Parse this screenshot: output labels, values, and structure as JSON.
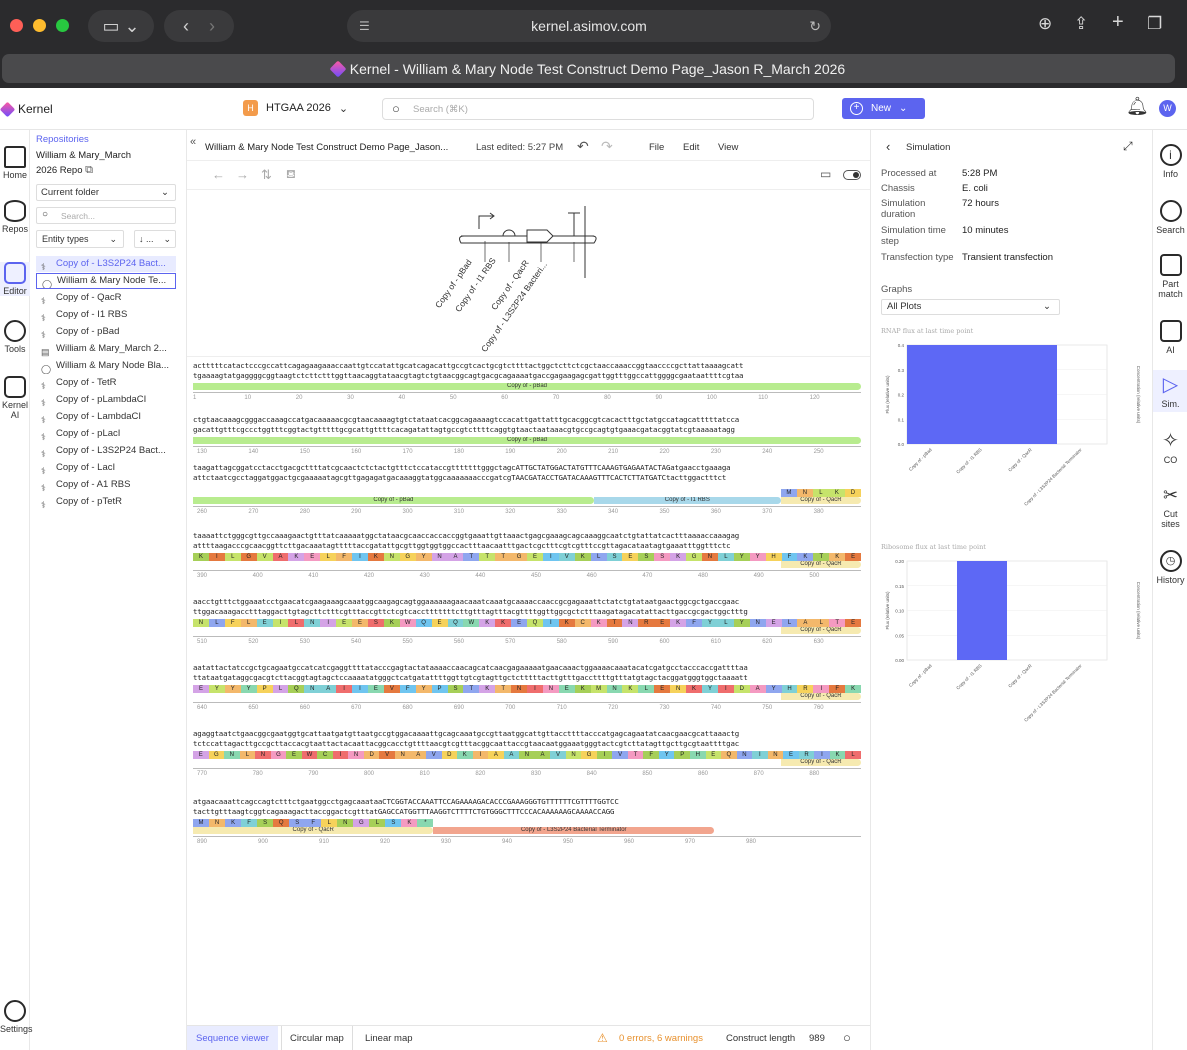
{
  "browser": {
    "url": "kernel.asimov.com",
    "tab_title": "Kernel - William & Mary Node Test Construct Demo Page_Jason R_March 2026"
  },
  "app": {
    "name": "Kernel",
    "workspace_badge": "H",
    "workspace": "HTGAA 2026",
    "search_placeholder": "Search (⌘K)",
    "new_label": "New",
    "avatar": "W"
  },
  "left_rail": [
    "Home",
    "Repos",
    "Editor",
    "Tools",
    "Kernel AI",
    "Settings"
  ],
  "repo_panel": {
    "breadcrumb": "Repositories",
    "repo_name": "William & Mary_March 2026 Repo",
    "folder_select": "Current folder",
    "search_placeholder": "Search...",
    "entity_types": "Entity types",
    "sort": "↓ ...",
    "entities": [
      {
        "label": "Copy of - L3S2P24 Bact...",
        "icon": "dna-icon",
        "state": "selected"
      },
      {
        "label": "William & Mary Node Te...",
        "icon": "construct-icon",
        "state": "active"
      },
      {
        "label": "Copy of - QacR",
        "icon": "dna-icon",
        "state": ""
      },
      {
        "label": "Copy of - I1 RBS",
        "icon": "dna-icon",
        "state": ""
      },
      {
        "label": "Copy of - pBad",
        "icon": "dna-icon",
        "state": ""
      },
      {
        "label": "William & Mary_March 2...",
        "icon": "document-icon",
        "state": ""
      },
      {
        "label": "William & Mary Node Bla...",
        "icon": "construct-icon",
        "state": ""
      },
      {
        "label": "Copy of - TetR",
        "icon": "dna-icon",
        "state": ""
      },
      {
        "label": "Copy of - pLambdaCI",
        "icon": "dna-icon",
        "state": ""
      },
      {
        "label": "Copy of - LambdaCI",
        "icon": "dna-icon",
        "state": ""
      },
      {
        "label": "Copy of - pLacI",
        "icon": "dna-icon",
        "state": ""
      },
      {
        "label": "Copy of - L3S2P24 Bact...",
        "icon": "dna-icon",
        "state": ""
      },
      {
        "label": "Copy of - LacI",
        "icon": "dna-icon",
        "state": ""
      },
      {
        "label": "Copy of - A1 RBS",
        "icon": "dna-icon",
        "state": ""
      },
      {
        "label": "Copy of - pTetR",
        "icon": "dna-icon",
        "state": ""
      }
    ]
  },
  "editor": {
    "doc_title": "William & Mary Node Test Construct Demo Page_Jason...",
    "last_edited": "Last edited: 5:27 PM",
    "menu": [
      "File",
      "Edit",
      "View"
    ],
    "construct_labels": [
      "Copy of - pBad",
      "Copy of - I1 RBS",
      "Copy of - QacR",
      "Copy of - L3S2P24 Bacteri..."
    ],
    "blocks": [
      {
        "top": "actttttcatactcccgccattcagagaagaaaccaattgtccatattgcatcagacattgccgtcactgcgtcttttactggctcttctcgctaaccaaaccggtaaccccgcttattaaaagcatt",
        "bottom": "tgaaaagtatgaggggcggtaagtctcttctttggttaacaggtataacgtagtctgtaacggcagtgacgcagaaaatgaccgagaagagcgattggtttggccattggggcgaataattttcgtaa",
        "features": [
          {
            "label": "Copy of - pBad",
            "color": "#b8ec8f",
            "kind": "pBad"
          }
        ],
        "ticks": [
          "1",
          "10",
          "20",
          "30",
          "40",
          "50",
          "60",
          "70",
          "80",
          "90",
          "100",
          "110",
          "120"
        ]
      },
      {
        "top": "ctgtaacaaagcgggaccaaagccatgacaaaaacgcgtaacaaaagtgtctataatcacggcagaaaagtccacattgattatttgcacggcgtcacactttgctatgccatagcatttttatcca",
        "bottom": "gacattgtttcgccctggtttcggtactgtttttgcgcattgttttcacagatattagtgccgtcttttcaggtgtaactaataaacgtgccgcagtgtgaaacgatacggtatcgtaaaaatagg",
        "features": [
          {
            "label": "Copy of - pBad",
            "color": "#b8ec8f",
            "kind": "pBad"
          }
        ],
        "ticks": [
          "130",
          "140",
          "150",
          "160",
          "170",
          "180",
          "190",
          "200",
          "210",
          "220",
          "230",
          "240",
          "250"
        ]
      },
      {
        "top": "taagattagcggatcctacctgacgcttttatcgcaactctctactgtttctccataccgtttttttgggctagcATTGCTATGGACTATGTTTCAAAGTGAGAATACTAGatgaacctgaaaga",
        "bottom": "attctaatcgcctaggatggactgcgaaaaatagcgttgagagatgacaaaggtatggcaaaaaaacccgatcgTAACGATACCTGATACAAAGTTTCACTCTTATGATCtacttggactttct",
        "features": [
          {
            "label": "Copy of - pBad",
            "color": "#b8ec8f",
            "kind": "pBad"
          },
          {
            "label": "Copy of - I1 RBS",
            "color": "#a8d8ea",
            "kind": "RBS"
          },
          {
            "label": "Copy of - QacR",
            "color": "#f6eab0",
            "kind": "QacR"
          }
        ],
        "aa_short": [
          "M",
          "N",
          "L",
          "K",
          "D"
        ],
        "ticks": [
          "260",
          "270",
          "280",
          "290",
          "300",
          "310",
          "320",
          "330",
          "340",
          "350",
          "360",
          "370",
          "380"
        ]
      },
      {
        "top": "taaaattctgggcgttgccaaagaactgtttatcaaaaatggctataacgcaaccaccaccggtgaaattgttaaactgagcgaaagcagcaaaggcaatctgtattatcactttaaaaccaaagag",
        "bottom": "attttaagacccgcaacggttcttgacaaatagtttttaccgatattgcgttggtggtggccactttaacaatttgactcgctttcgtcgtttccgttagacataatagtgaaatttggtttctc",
        "features": [
          {
            "label": "Copy of - QacR",
            "color": "#f6eab0",
            "kind": "QacR"
          }
        ],
        "aa": "KILGVAKELFIKNGYNATTTGEIVKLSESSKGNLYYHFKTKE",
        "ticks": [
          "390",
          "400",
          "410",
          "420",
          "430",
          "440",
          "450",
          "460",
          "470",
          "480",
          "490",
          "500"
        ]
      },
      {
        "top": "aacctgtttctggaaatcctgaacatcgaagaaagcaaatggcaagagcagtggaaaaaagaacaaatcaaatgcaaaaccaaccgcgagaaattctatctgtataatgaactggcgctgaccgaac",
        "bottom": "ttggacaaagacctttaggacttgtagcttctttcgtttaccgttctcgtcacctttttttcttgtttagtttacgttttggttggcgctctttaagatagacatattacttgaccgcgactggctttg",
        "features": [
          {
            "label": "Copy of - QacR",
            "color": "#f6eab0",
            "kind": "QacR"
          }
        ],
        "aa": "NLFLEILNIEESKWQEQWKKEQIKCKTNREKFYLYNELALTE",
        "ticks": [
          "510",
          "520",
          "530",
          "540",
          "550",
          "560",
          "570",
          "580",
          "590",
          "600",
          "610",
          "620",
          "630"
        ]
      },
      {
        "top": "aatattactatccgctgcagaatgccatcatcgaggttttatacccgagtactataaaaccaacagcatcaacgagaaaaatgaacaaactggaaaacaaatacatcgatgcctacccaccgattttaa",
        "bottom": "ttataatgataggcgacgtcttacggtagtagctccaaaatatgggctcatgatattttggttgtcgtagttgctctttttacttgtttgaccttttgtttatgtagctacggatgggtggctaaaatt",
        "features": [
          {
            "label": "Copy of - QacR",
            "color": "#f6eab0",
            "kind": "QacR"
          }
        ],
        "aa": "EYYYPLQNAIIEVFYPSTKTNINEKMNKLENKYIDAYHRIFK",
        "ticks": [
          "640",
          "650",
          "660",
          "670",
          "680",
          "690",
          "700",
          "710",
          "720",
          "730",
          "740",
          "750",
          "760"
        ]
      },
      {
        "top": "agaggtaatctgaacggcgaatggtgcattaatgatgttaatgccgtggacaaaattgcagcaaatgccgttaatggcattgttaccttttacccatgagcagaatatcaacgaacgcattaaactg",
        "bottom": "tctccattagacttgccgcttaccacgtaattactacaattacggcacctgttttaacgtcgtttacggcaattaccgtaacaatggaaatgggtactcgtcttatagttgcttgcgtaattttgac",
        "features": [
          {
            "label": "Copy of - QacR",
            "color": "#f6eab0",
            "kind": "QacR"
          }
        ],
        "aa": "EGNLNGEWCINDVNAVDKIAANAVNGIVTFYPHEQNINERIKL",
        "ticks": [
          "770",
          "780",
          "790",
          "800",
          "810",
          "820",
          "830",
          "840",
          "850",
          "860",
          "870",
          "880"
        ]
      },
      {
        "top": "atgaacaaattcagccagtctttctgaatggcctgagcaaataaCTCGGTACCAAATTCCAGAAAAGACACCCGAAAGGGTGTTTTTTCGTTTTGGTCC",
        "bottom": "tacttgtttaagtcggtcagaaagacttaccggactcgtttatGAGCCATGGTTTAAGGTCTTTTCTGTGGGCTTTCCCACAAAAAAGCAAAACCAGG",
        "features": [
          {
            "label": "Copy of - QacR",
            "color": "#f6eab0",
            "kind": "QacR"
          },
          {
            "label": "Copy of - L3S2P24 Bacterial Terminator",
            "color": "#f2a58e",
            "kind": "Term"
          }
        ],
        "aa": "MNKFSQSFLNGLSK*",
        "ticks": [
          "890",
          "900",
          "910",
          "920",
          "930",
          "940",
          "950",
          "960",
          "970",
          "980"
        ]
      }
    ],
    "footer": {
      "tabs": [
        "Sequence viewer",
        "Circular map",
        "Linear map"
      ],
      "warnings": "0 errors, 6 warnings",
      "length_label": "Construct length",
      "length_value": "989"
    }
  },
  "simulation": {
    "title": "Simulation",
    "fields": [
      {
        "label": "Processed at",
        "value": "5:28 PM"
      },
      {
        "label": "Chassis",
        "value": "E. coli"
      },
      {
        "label": "Simulation duration",
        "value": "72 hours"
      },
      {
        "label": "Simulation time step",
        "value": "10 minutes"
      },
      {
        "label": "Transfection type",
        "value": "Transient transfection"
      }
    ],
    "graphs_label": "Graphs",
    "graphs_select": "All Plots"
  },
  "right_rail": [
    "Info",
    "Search",
    "Part match",
    "AI",
    "Sim.",
    "CO",
    "Cut sites",
    "History"
  ],
  "chart_data": [
    {
      "type": "bar",
      "title": "RNAP flux at last time point",
      "ylabel": "Flux (relative units)",
      "y2label": "Concentration (relative units)",
      "categories": [
        "Copy of - pBad",
        "Copy of - I1 RBS",
        "Copy of - QacR",
        "Copy of - L3S2P24 Bacterial Terminator"
      ],
      "values": [
        0.4,
        0.4,
        0.4,
        0
      ],
      "ylim": [
        0,
        0.4
      ],
      "yticks": [
        "0.0",
        "0.1",
        "0.2",
        "0.3",
        "0.4"
      ],
      "color": "#5d68f5"
    },
    {
      "type": "bar",
      "title": "Ribosome flux at last time point",
      "ylabel": "Flux (relative units)",
      "y2label": "Concentration (relative units)",
      "categories": [
        "Copy of - pBad",
        "Copy of - I1 RBS",
        "Copy of - QacR",
        "Copy of - L3S2P24 Bacterial Terminator"
      ],
      "values": [
        0,
        0.2,
        0,
        0
      ],
      "ylim": [
        0,
        0.2
      ],
      "yticks": [
        "0.00",
        "0.05",
        "0.10",
        "0.15",
        "0.20"
      ],
      "color": "#5d68f5"
    }
  ]
}
